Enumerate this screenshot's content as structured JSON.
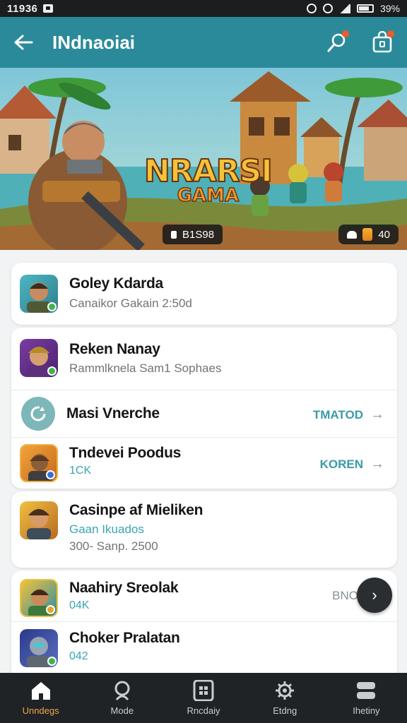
{
  "status_bar": {
    "time": "11936",
    "battery": "39%"
  },
  "app_bar": {
    "title": "INdnaoiai"
  },
  "banner": {
    "logo_line1": "NRARSI",
    "logo_line2": "GAMA",
    "id_text": "B1S98",
    "likes_text": "40"
  },
  "list": [
    {
      "title": "Goley Kdarda",
      "subtitle": "Canaikor Gakain 2:50d"
    },
    {
      "title": "Reken Nanay",
      "subtitle": "Rammlknela Sam1 Sophaes"
    },
    {
      "title": "Masi Vnerche",
      "link": "TMATOD"
    },
    {
      "title": "Tndevei Poodus",
      "subtitle": "1CK",
      "link": "KOREN"
    },
    {
      "title": "Casinpe af Mieliken",
      "subtitle": "Gaan Ikuados",
      "detail": "300- Sanp. 2500"
    },
    {
      "title": "Naahiry Sreolak",
      "subtitle": "04K",
      "link": "BNO"
    },
    {
      "title": "Choker Pralatan",
      "subtitle": "042"
    }
  ],
  "bottom_nav": [
    {
      "label": "Unndegs",
      "icon": "home-icon",
      "active": true
    },
    {
      "label": "Mode",
      "icon": "search-icon",
      "active": false
    },
    {
      "label": "Rncdaiy",
      "icon": "grid-icon",
      "active": false
    },
    {
      "label": "Etdng",
      "icon": "gear-icon",
      "active": false
    },
    {
      "label": "Ihetiny",
      "icon": "layers-icon",
      "active": false
    }
  ],
  "colors": {
    "appbar": "#2b8a99",
    "accent": "#f3a44a",
    "teal_text": "#38a6b3",
    "nav_bg": "#1f2326"
  }
}
